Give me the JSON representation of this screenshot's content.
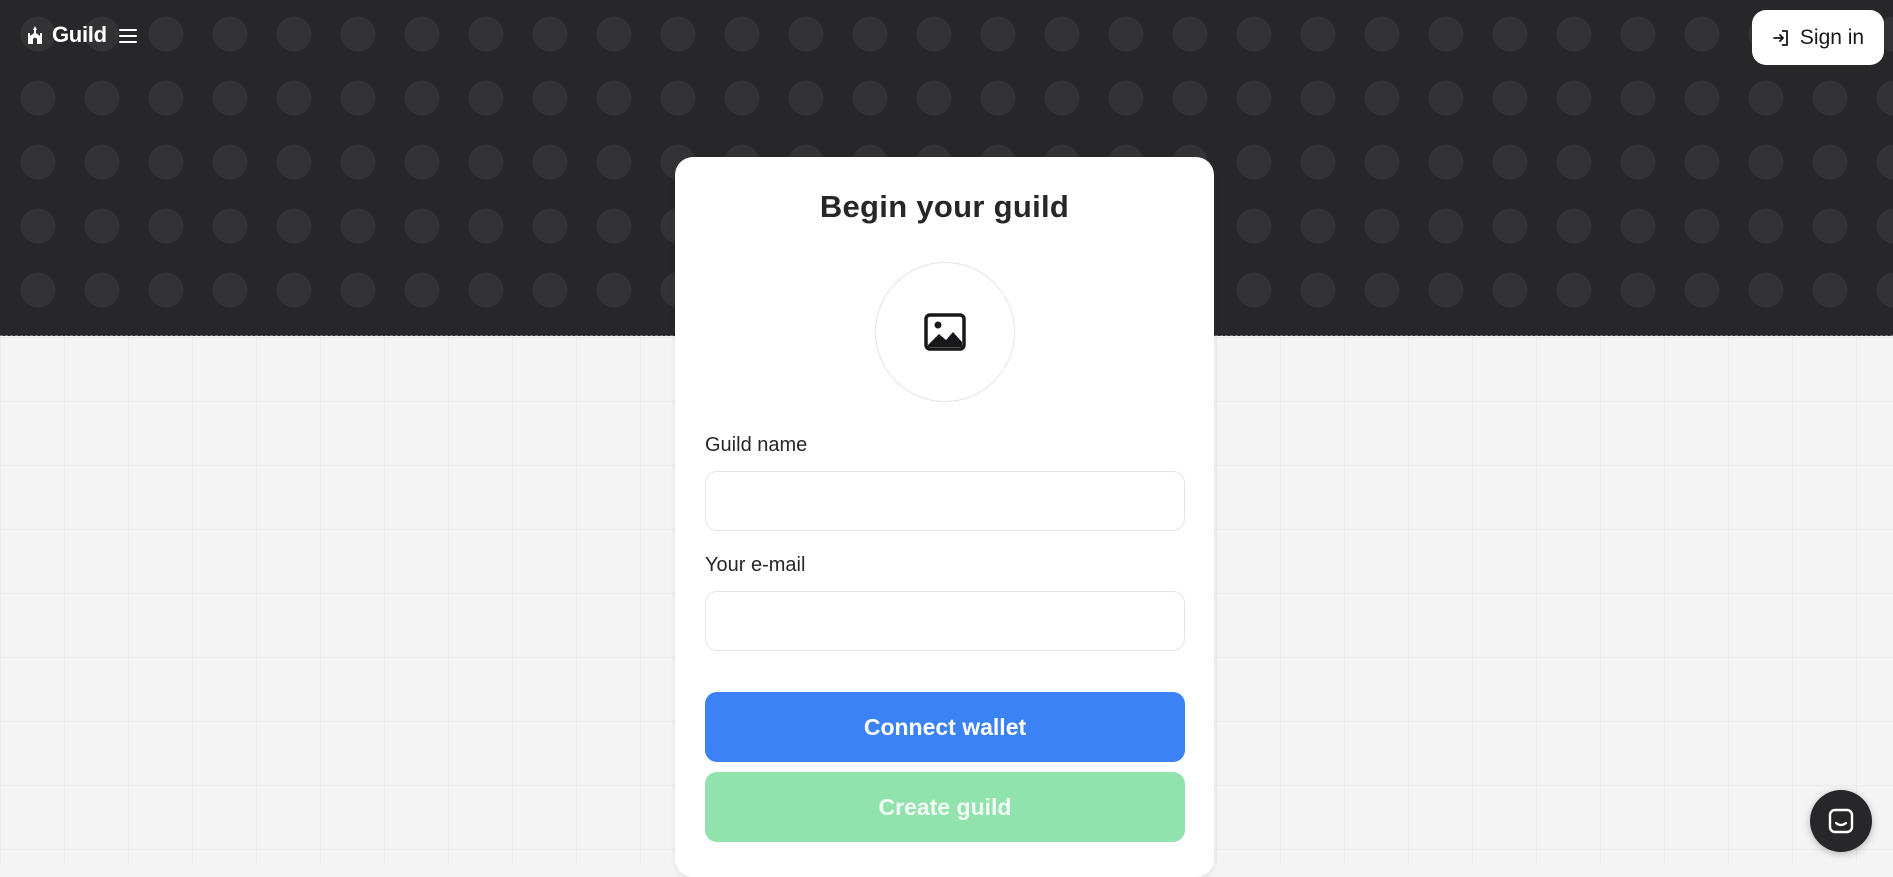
{
  "header": {
    "brand_name": "Guild",
    "brand_icon": "guild-castle-icon",
    "menu_icon": "hamburger-icon",
    "signin_label": "Sign in",
    "signin_icon": "sign-in-icon"
  },
  "form": {
    "title": "Begin your guild",
    "image_picker_icon": "image-icon",
    "guild_name_label": "Guild name",
    "guild_name_value": "",
    "email_label": "Your e-mail",
    "email_value": "",
    "connect_wallet_label": "Connect wallet",
    "create_guild_label": "Create guild"
  },
  "widgets": {
    "chat_icon": "chat-icon"
  },
  "colors": {
    "hero_background": "#27272a",
    "page_background": "#f4f4f5",
    "primary_blue": "#3b82f6",
    "disabled_green": "#91e3ae"
  }
}
